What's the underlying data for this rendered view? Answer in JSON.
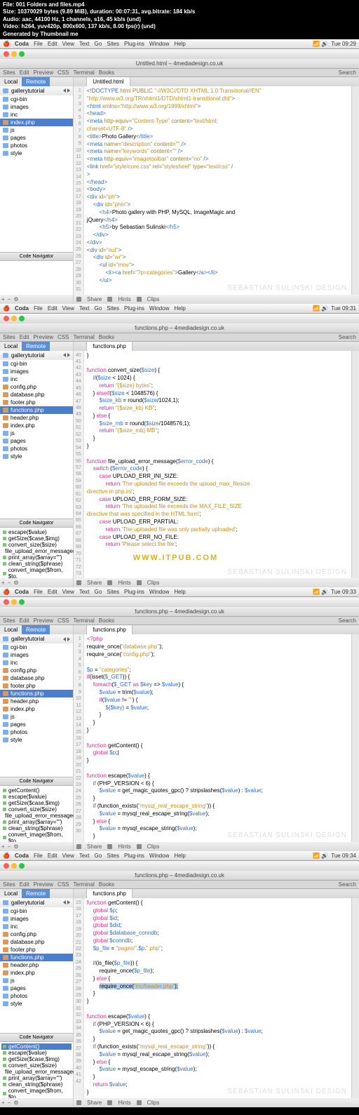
{
  "header": {
    "l1": "File: 001 Folders and files.mp4",
    "l2": "Size: 10370029 bytes (9.89 MiB), duration: 00:07:31, avg.bitrate: 184 kb/s",
    "l3": "Audio: aac, 44100 Hz, 1 channels, s16, 45 kb/s (und)",
    "l4": "Video: h264, yuv420p, 800x600, 137 kb/s, 8.00 fps(r) (und)",
    "l5": "Generated by Thumbnail me"
  },
  "menu": {
    "app": "Coda",
    "items": [
      "File",
      "Edit",
      "View",
      "Text",
      "Go",
      "Sites",
      "Plug-ins",
      "Window",
      "Help"
    ]
  },
  "times": [
    "Tue 09:29",
    "Tue 09:31",
    "Tue 09:33",
    "Tue 09:34"
  ],
  "tabs_row": [
    "Sites",
    "Edit",
    "Preview",
    "CSS",
    "Terminal",
    "Books"
  ],
  "side": {
    "local": "Local",
    "remote": "Remote",
    "crumb": "gallerytutorial",
    "navlabel": "Code Navigator"
  },
  "p1": {
    "title": "Untitled.html – 4mediadesign.co.uk",
    "files": [
      "cgi-bin",
      "images",
      "inc",
      "index.php",
      "js",
      "pages",
      "photos",
      "style"
    ],
    "sel": "index.php",
    "tabs": [
      "Untitled.html"
    ],
    "gstart": 1,
    "gend": 31
  },
  "p2": {
    "title": "functions.php – 4mediadesign.co.uk",
    "files": [
      "cgi-bin",
      "images",
      "inc",
      "config.php",
      "database.php",
      "footer.php",
      "functions.php",
      "header.php",
      "index.php",
      "js",
      "pages",
      "photos",
      "style"
    ],
    "sel": "functions.php",
    "nav": [
      "escape($value)",
      "getSize($case,$img)",
      "convert_size($size)",
      "file_upload_error_message(",
      "print_array($array=\"\")",
      "clean_string($phrase)",
      "convert_image($from, $to,"
    ],
    "tabs": [
      "functions.php"
    ],
    "gstart": 40,
    "gend": 73
  },
  "p3": {
    "title": "functions.php – 4mediadesign.co.uk",
    "files": [
      "cgi-bin",
      "images",
      "inc",
      "config.php",
      "database.php",
      "footer.php",
      "functions.php",
      "header.php",
      "index.php",
      "js",
      "pages",
      "photos",
      "style"
    ],
    "sel": "functions.php",
    "nav": [
      "getContent()",
      "escape($value)",
      "getSize($case,$img)",
      "convert_size($size)",
      "file_upload_error_message(",
      "print_array($array=\"\")",
      "clean_string($phrase)",
      "convert_image($from, $to,"
    ],
    "tabs": [
      "functions.php"
    ],
    "gstart": 1,
    "gend": 30
  },
  "p4": {
    "title": "functions.php – 4mediadesign.co.uk",
    "files": [
      "cgi-bin",
      "images",
      "inc",
      "config.php",
      "database.php",
      "footer.php",
      "functions.php",
      "header.php",
      "index.php",
      "js",
      "pages",
      "photos",
      "style"
    ],
    "sel": "functions.php",
    "nav": [
      "getContent()",
      "escape($value)",
      "getSize($case,$img)",
      "convert_size($size)",
      "file_upload_error_message(",
      "print_array($array=\"\")",
      "clean_string($phrase)",
      "convert_image($from, $to,"
    ],
    "tabs": [
      "functions.php"
    ],
    "gstart": 15,
    "gend": 42
  },
  "botbar": [
    "Share",
    "Hints",
    "Clips"
  ],
  "search": "Search",
  "wm": "SEBASTIAN SULINSKI DESIGN"
}
